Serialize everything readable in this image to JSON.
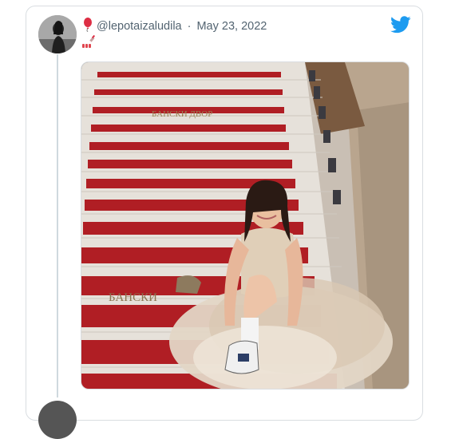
{
  "tweet": {
    "handle": "@lepotaizaludila",
    "separator": "·",
    "date": "May 23, 2022",
    "name_emoji": "balloon-emoji",
    "bio_emoji": "lipstick-nails-emoji",
    "brand_icon": "twitter-bird-icon",
    "brand_color": "#1d9bf0"
  },
  "media": {
    "kind": "photo",
    "stair_inscription": "БАНСКИ ДВОР",
    "stair_inscription_lower": "БАНСКИ"
  }
}
